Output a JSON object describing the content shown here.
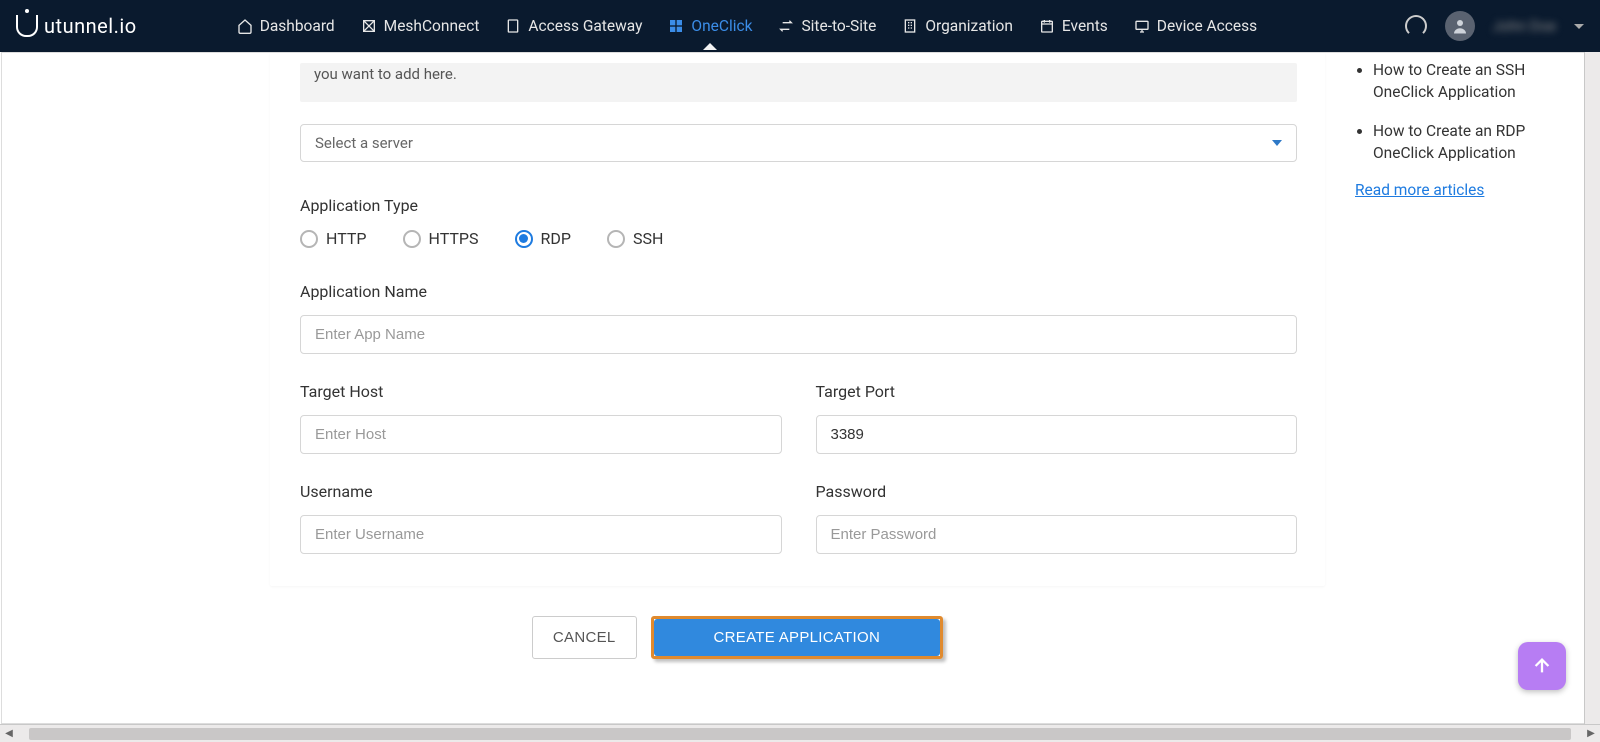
{
  "brand": "utunnel.io",
  "nav": {
    "items": [
      {
        "label": "Dashboard",
        "icon": "home-icon",
        "active": false
      },
      {
        "label": "MeshConnect",
        "icon": "mesh-icon",
        "active": false
      },
      {
        "label": "Access Gateway",
        "icon": "gateway-icon",
        "active": false
      },
      {
        "label": "OneClick",
        "icon": "grid-icon",
        "active": true
      },
      {
        "label": "Site-to-Site",
        "icon": "transfer-icon",
        "active": false
      },
      {
        "label": "Organization",
        "icon": "building-icon",
        "active": false
      },
      {
        "label": "Events",
        "icon": "calendar-icon",
        "active": false
      },
      {
        "label": "Device Access",
        "icon": "monitor-icon",
        "active": false
      }
    ],
    "user_name": "John Doe"
  },
  "form": {
    "info_text": "you want to add here.",
    "server_select_placeholder": "Select a server",
    "application_type": {
      "label": "Application Type",
      "options": [
        "HTTP",
        "HTTPS",
        "RDP",
        "SSH"
      ],
      "selected": "RDP"
    },
    "application_name": {
      "label": "Application Name",
      "placeholder": "Enter App Name",
      "value": ""
    },
    "target_host": {
      "label": "Target Host",
      "placeholder": "Enter Host",
      "value": ""
    },
    "target_port": {
      "label": "Target Port",
      "placeholder": "",
      "value": "3389"
    },
    "username": {
      "label": "Username",
      "placeholder": "Enter Username",
      "value": ""
    },
    "password": {
      "label": "Password",
      "placeholder": "Enter Password",
      "value": ""
    },
    "cancel_label": "CANCEL",
    "submit_label": "CREATE APPLICATION"
  },
  "sidebar": {
    "articles": [
      "How to Create an SSH OneClick Application",
      "How to Create an RDP OneClick Application"
    ],
    "more_link": "Read more articles"
  },
  "colors": {
    "nav_bg": "#0a1a2e",
    "accent": "#3089de",
    "highlight_border": "#e08a2e",
    "fab": "#b77df3"
  }
}
